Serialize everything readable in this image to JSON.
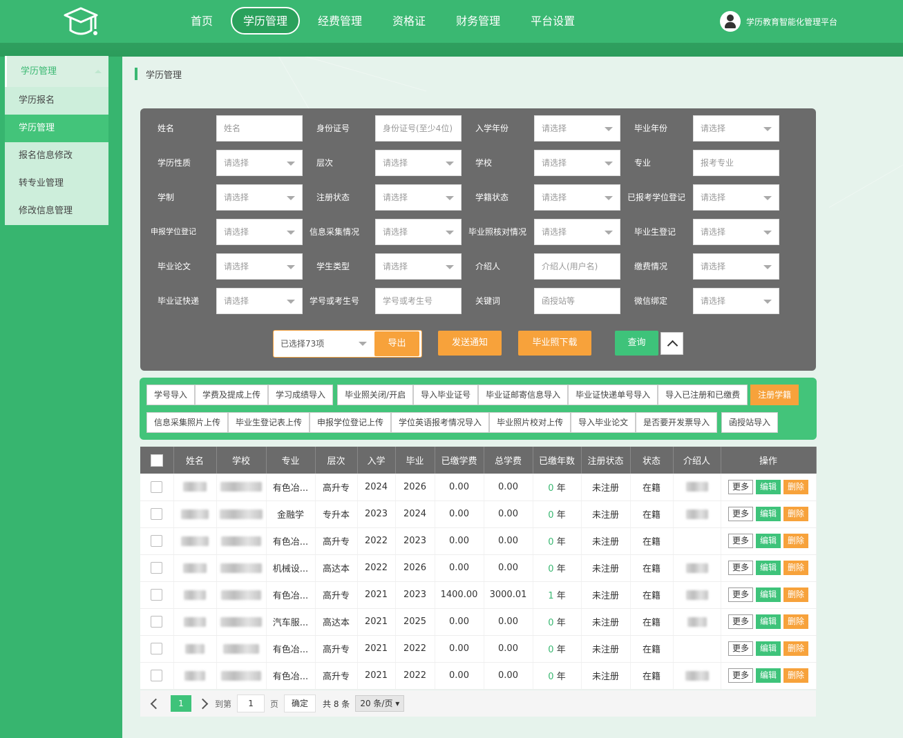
{
  "header": {
    "nav": [
      "首页",
      "学历管理",
      "经费管理",
      "资格证",
      "财务管理",
      "平台设置"
    ],
    "active_nav": "学历管理",
    "platform_name": "学历教育智能化管理平台"
  },
  "sidebar": {
    "group_title": "学历管理",
    "items": [
      "学历报名",
      "学历管理",
      "报名信息修改",
      "转专业管理",
      "修改信息管理"
    ],
    "active_item": "学历管理"
  },
  "breadcrumb": "学历管理",
  "filters": {
    "name_label": "姓名",
    "name_placeholder": "姓名",
    "id_label": "身份证号",
    "id_placeholder": "身份证号(至少4位)",
    "enroll_year_label": "入学年份",
    "enroll_year_value": "请选择",
    "grad_year_label": "毕业年份",
    "grad_year_value": "请选择",
    "edu_nature_label": "学历性质",
    "edu_nature_value": "请选择",
    "level_label": "层次",
    "level_value": "请选择",
    "school_label": "学校",
    "school_value": "请选择",
    "major_label": "专业",
    "major_placeholder": "报考专业",
    "system_label": "学制",
    "system_value": "请选择",
    "reg_status_label": "注册状态",
    "reg_status_value": "请选择",
    "roll_status_label": "学籍状态",
    "roll_status_value": "请选择",
    "degree_reg_label": "已报考学位登记",
    "degree_reg_value": "请选择",
    "apply_degree_label": "申报学位登记",
    "apply_degree_value": "请选择",
    "info_collect_label": "信息采集情况",
    "info_collect_value": "请选择",
    "photo_check_label": "毕业照核对情况",
    "photo_check_value": "请选择",
    "grad_reg_label": "毕业生登记",
    "grad_reg_value": "请选择",
    "thesis_label": "毕业论文",
    "thesis_value": "请选择",
    "student_type_label": "学生类型",
    "student_type_value": "请选择",
    "referrer_label": "介绍人",
    "referrer_placeholder": "介绍人(用户名)",
    "payment_label": "缴费情况",
    "payment_value": "请选择",
    "cert_express_label": "毕业证快递",
    "cert_express_value": "请选择",
    "student_no_label": "学号或考生号",
    "student_no_placeholder": "学号或考生号",
    "keyword_label": "关键词",
    "keyword_placeholder": "函授站等",
    "wechat_label": "微信绑定",
    "wechat_value": "请选择"
  },
  "actions": {
    "export_select": "已选择73项",
    "export": "导出",
    "notify": "发送通知",
    "photo_download": "毕业照下载",
    "query": "查询"
  },
  "tools": {
    "row1": [
      "学号导入",
      "学费及提成上传",
      "学习成绩导入",
      "毕业照关闭/开启",
      "导入毕业证号",
      "毕业证邮寄信息导入",
      "毕业证快递单号导入",
      "导入已注册和已缴费",
      "注册学籍"
    ],
    "row2": [
      "信息采集照片上传",
      "毕业生登记表上传",
      "申报学位登记上传",
      "学位英语报考情况导入",
      "毕业照片校对上传",
      "导入毕业论文",
      "是否要开发票导入",
      "函授站导入"
    ]
  },
  "table": {
    "headers": [
      "姓名",
      "学校",
      "专业",
      "层次",
      "入学",
      "毕业",
      "已缴学费",
      "总学费",
      "已缴年数",
      "注册状态",
      "状态",
      "介绍人",
      "操作"
    ],
    "year_unit": "年",
    "ops": {
      "more": "更多",
      "edit": "编辑",
      "delete": "删除"
    },
    "rows": [
      {
        "major": "有色冶...",
        "level": "高升专",
        "enroll": "2024",
        "grad": "2026",
        "paid": "0.00",
        "total": "0.00",
        "years": "0",
        "reg": "未注册",
        "status": "在籍",
        "has_ref": true
      },
      {
        "major": "金融学",
        "level": "专升本",
        "enroll": "2023",
        "grad": "2024",
        "paid": "0.00",
        "total": "0.00",
        "years": "0",
        "reg": "未注册",
        "status": "在籍",
        "has_ref": true
      },
      {
        "major": "有色冶...",
        "level": "高升专",
        "enroll": "2022",
        "grad": "2023",
        "paid": "0.00",
        "total": "0.00",
        "years": "0",
        "reg": "未注册",
        "status": "在籍",
        "has_ref": false
      },
      {
        "major": "机械设...",
        "level": "高达本",
        "enroll": "2022",
        "grad": "2026",
        "paid": "0.00",
        "total": "0.00",
        "years": "0",
        "reg": "未注册",
        "status": "在籍",
        "has_ref": true
      },
      {
        "major": "有色冶...",
        "level": "高升专",
        "enroll": "2021",
        "grad": "2023",
        "paid": "1400.00",
        "total": "3000.01",
        "years": "1",
        "reg": "未注册",
        "status": "在籍",
        "has_ref": true
      },
      {
        "major": "汽车服...",
        "level": "高达本",
        "enroll": "2021",
        "grad": "2025",
        "paid": "0.00",
        "total": "0.00",
        "years": "0",
        "reg": "未注册",
        "status": "在籍",
        "has_ref": true
      },
      {
        "major": "有色冶...",
        "level": "高升专",
        "enroll": "2021",
        "grad": "2022",
        "paid": "0.00",
        "total": "0.00",
        "years": "0",
        "reg": "未注册",
        "status": "在籍",
        "has_ref": false
      },
      {
        "major": "有色冶...",
        "level": "高升专",
        "enroll": "2021",
        "grad": "2022",
        "paid": "0.00",
        "total": "0.00",
        "years": "0",
        "reg": "未注册",
        "status": "在籍",
        "has_ref": true
      }
    ]
  },
  "pager": {
    "current": "1",
    "goto_label": "到第",
    "goto_value": "1",
    "page_label": "页",
    "confirm": "确定",
    "total": "共 8 条",
    "page_size": "20 条/页"
  }
}
